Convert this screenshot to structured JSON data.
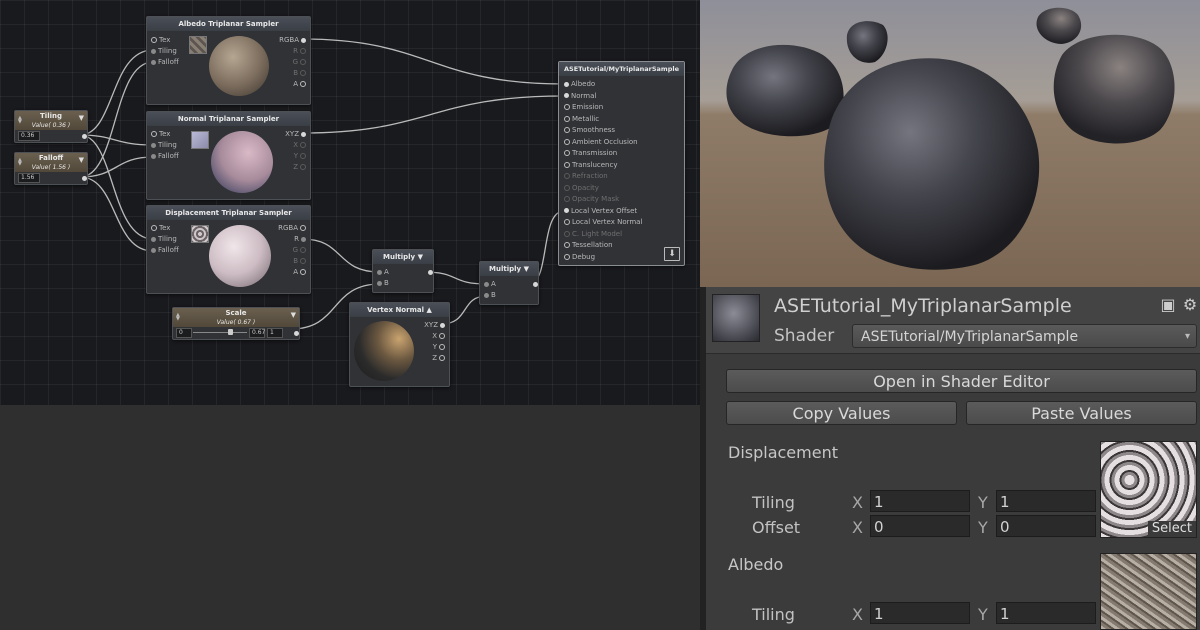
{
  "graph": {
    "nodes": {
      "albedo_sampler": {
        "title": "Albedo Triplanar Sampler",
        "inputs": [
          "Tex",
          "Tiling",
          "Falloff"
        ],
        "outputs": [
          "RGBA",
          "R",
          "G",
          "B",
          "A"
        ]
      },
      "normal_sampler": {
        "title": "Normal Triplanar Sampler",
        "inputs": [
          "Tex",
          "Tiling",
          "Falloff"
        ],
        "outputs": [
          "XYZ",
          "X",
          "Y",
          "Z"
        ]
      },
      "displacement_sampler": {
        "title": "Displacement Triplanar Sampler",
        "inputs": [
          "Tex",
          "Tiling",
          "Falloff"
        ],
        "outputs": [
          "RGBA",
          "R",
          "G",
          "B",
          "A"
        ]
      },
      "tiling": {
        "title": "Tiling",
        "subtitle": "Value( 0.36 )",
        "value": "0.36"
      },
      "falloff": {
        "title": "Falloff",
        "subtitle": "Value( 1.56 )",
        "value": "1.56"
      },
      "scale": {
        "title": "Scale",
        "subtitle": "Value( 0.67 )",
        "min": "0",
        "current": "0.67",
        "max": "1"
      },
      "multiply1": {
        "title": "Multiply",
        "inputs": [
          "A",
          "B"
        ]
      },
      "multiply2": {
        "title": "Multiply",
        "inputs": [
          "A",
          "B"
        ]
      },
      "vertex_normal": {
        "title": "Vertex Normal",
        "outputs": [
          "XYZ",
          "X",
          "Y",
          "Z"
        ]
      },
      "output": {
        "title": "ASETutorial/MyTriplanarSample",
        "inputs": [
          "Albedo",
          "Normal",
          "Emission",
          "Metallic",
          "Smoothness",
          "Ambient Occlusion",
          "Transmission",
          "Translucency",
          "Refraction",
          "Opacity",
          "Opacity Mask",
          "Local Vertex Offset",
          "Local Vertex Normal",
          "C. Light Model",
          "Tessellation",
          "Debug"
        ]
      }
    }
  },
  "inspector": {
    "material_name": "ASETutorial_MyTriplanarSample",
    "shader_label": "Shader",
    "shader_value": "ASETutorial/MyTriplanarSample",
    "open_button": "Open in Shader Editor",
    "copy_button": "Copy Values",
    "paste_button": "Paste Values",
    "sections": [
      {
        "title": "Displacement",
        "tiling_label": "Tiling",
        "offset_label": "Offset",
        "tiling_x": "1",
        "tiling_y": "1",
        "offset_x": "0",
        "offset_y": "0",
        "select_label": "Select"
      },
      {
        "title": "Albedo",
        "tiling_label": "Tiling",
        "tiling_x": "1",
        "tiling_y": "1"
      }
    ],
    "x_label": "X",
    "y_label": "Y"
  },
  "colors": {
    "graph_bg": "#191a1d",
    "node_bg": "#303236",
    "inspector_bg": "#3b3b3b",
    "wire": "#d6d6d6"
  }
}
